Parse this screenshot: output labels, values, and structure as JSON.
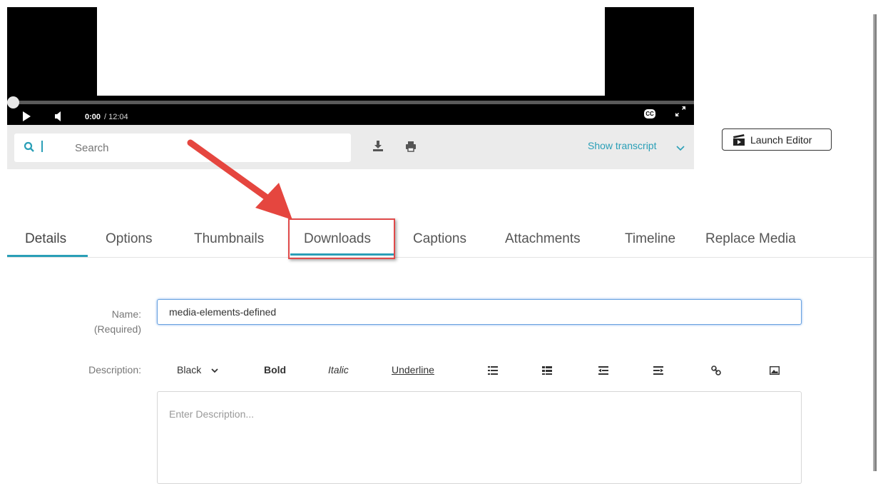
{
  "player": {
    "time_current": "0:00",
    "time_total": "/ 12:04",
    "progress": 0,
    "cc_label": "CC"
  },
  "search": {
    "placeholder": "Search",
    "show_transcript": "Show transcript"
  },
  "launch_editor": "Launch Editor",
  "tabs": {
    "items": [
      "Details",
      "Options",
      "Thumbnails",
      "Downloads",
      "Captions",
      "Attachments",
      "Timeline",
      "Replace Media"
    ],
    "active": "Details",
    "highlighted": "Downloads"
  },
  "form": {
    "name_label": "Name:",
    "name_required": "(Required)",
    "name_value": "media-elements-defined",
    "description_label": "Description:",
    "toolbar": {
      "color": "Black",
      "bold": "Bold",
      "italic": "Italic",
      "underline": "Underline"
    },
    "description_placeholder": "Enter Description..."
  },
  "colors": {
    "accent": "#2a9fb7",
    "highlight": "#e04a4a"
  }
}
